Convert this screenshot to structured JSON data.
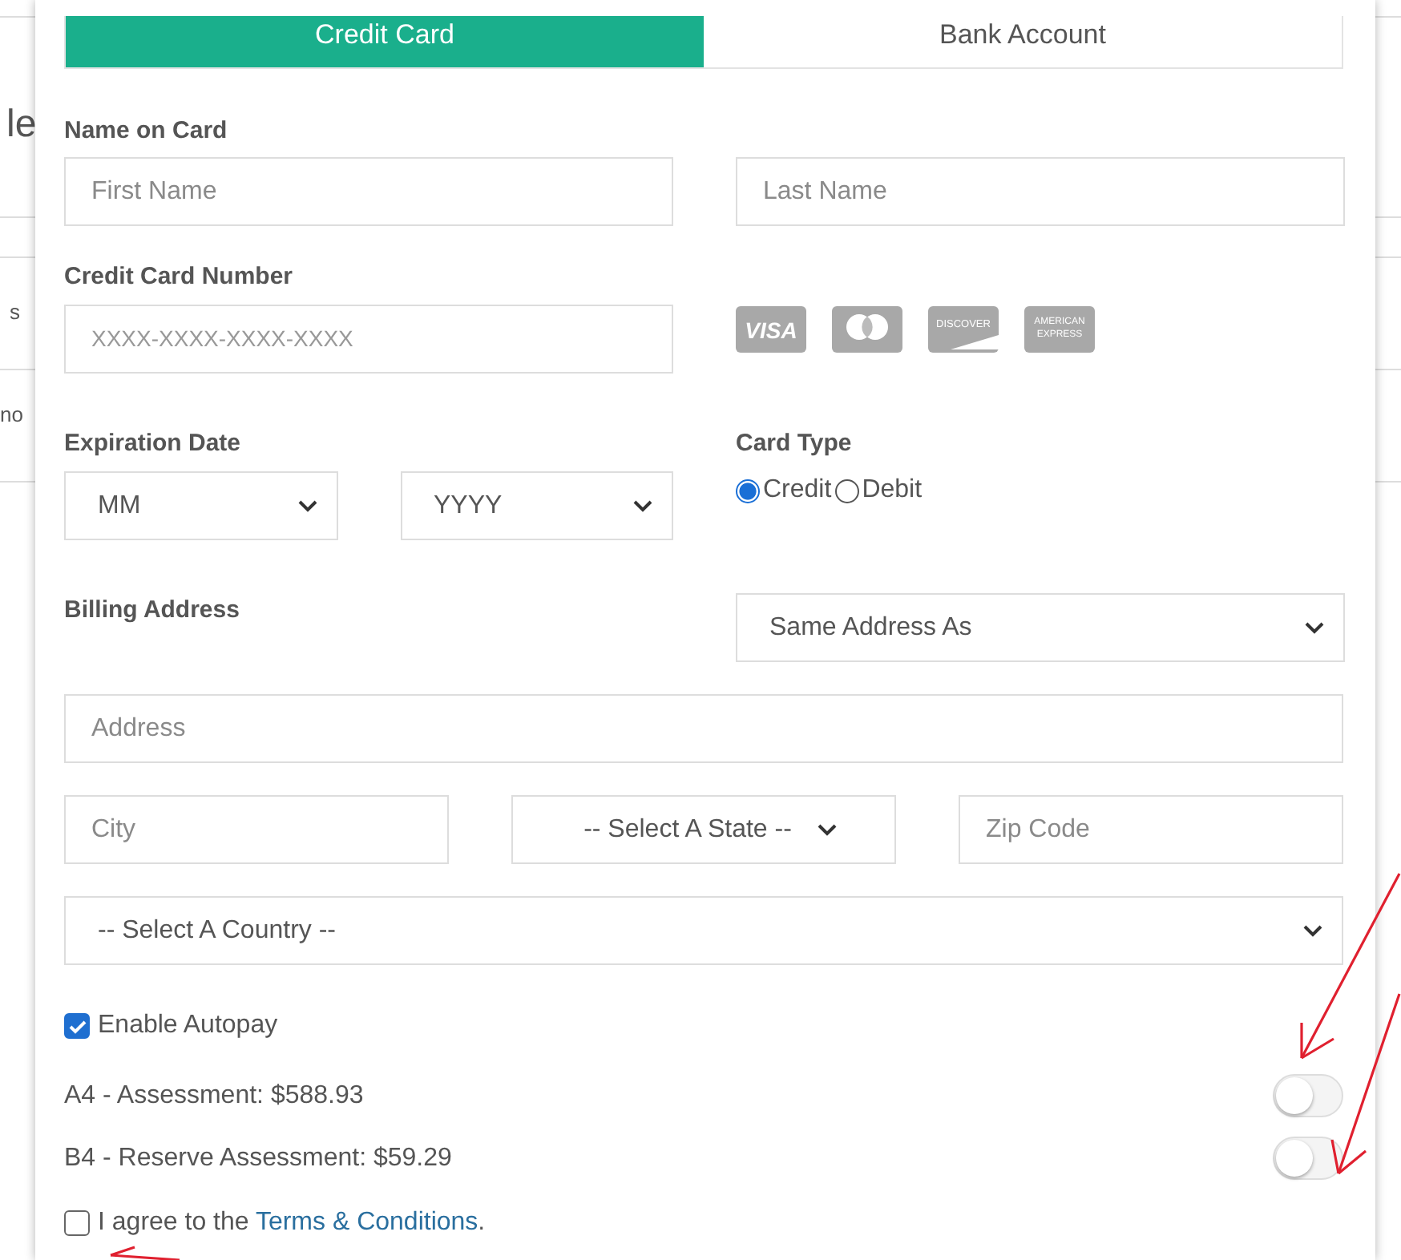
{
  "background_page": {
    "fragments": [
      "le",
      "s",
      "no"
    ]
  },
  "tabs": [
    {
      "label": "Credit Card",
      "selected": true
    },
    {
      "label": "Bank Account",
      "selected": false
    }
  ],
  "name_on_card": {
    "label": "Name on Card",
    "first_name": {
      "placeholder": "First Name"
    },
    "last_name": {
      "placeholder": "Last Name"
    }
  },
  "card_number": {
    "label": "Credit Card Number",
    "placeholder": "XXXX-XXXX-XXXX-XXXX"
  },
  "card_logos": [
    {
      "kind": "visa",
      "lines": [
        "VISA"
      ]
    },
    {
      "kind": "mastercard"
    },
    {
      "kind": "discover",
      "lines": [
        "DISCOVER"
      ]
    },
    {
      "kind": "amex",
      "lines": [
        "AMERICAN",
        "EXPRESS"
      ]
    }
  ],
  "expiration": {
    "label": "Expiration Date",
    "month": "MM",
    "year": "YYYY"
  },
  "card_type": {
    "label": "Card Type",
    "options": [
      {
        "label": "Credit",
        "selected": true
      },
      {
        "label": "Debit",
        "selected": false
      }
    ]
  },
  "billing": {
    "label": "Billing Address",
    "same_as": "Same Address As",
    "address": {
      "placeholder": "Address"
    },
    "city": {
      "placeholder": "City"
    },
    "state": "-- Select A State --",
    "zip": {
      "placeholder": "Zip Code"
    },
    "country": "-- Select A Country --"
  },
  "autopay": {
    "label": "Enable Autopay",
    "checked": true
  },
  "autopay_items": [
    {
      "label": "A4 - Assessment: $588.93",
      "on": false
    },
    {
      "label": "B4 - Reserve Assessment: $59.29",
      "on": false
    }
  ],
  "agree": {
    "checked": false,
    "text": "I agree to the ",
    "link": "Terms & Conditions",
    "end": "."
  }
}
